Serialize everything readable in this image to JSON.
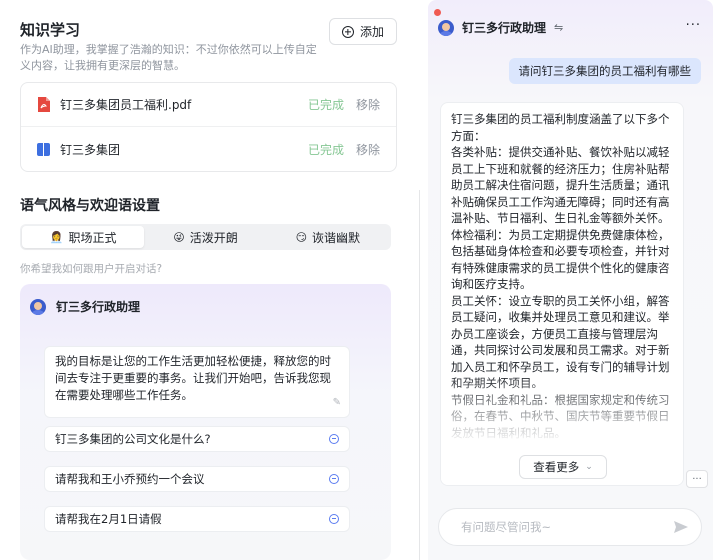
{
  "knowledge": {
    "title": "知识学习",
    "description": "作为AI助理，我掌握了浩瀚的知识：不过你依然可以上传自定义内容，让我拥有更深层的智慧。",
    "add_label": "添加",
    "files": [
      {
        "name": "钉三多集团员工福利.pdf",
        "status": "已完成",
        "remove": "移除",
        "icon": "pdf-icon"
      },
      {
        "name": "钉三多集团",
        "status": "已完成",
        "remove": "移除",
        "icon": "book-icon"
      }
    ]
  },
  "tone": {
    "title": "语气风格与欢迎语设置",
    "options": [
      {
        "emoji": "👩‍💼",
        "label": "职场正式",
        "active": true
      },
      {
        "emoji": "😜",
        "label": "活泼开朗",
        "active": false
      },
      {
        "emoji": "😏",
        "label": "诙谐幽默",
        "active": false
      }
    ],
    "hint": "你希望我如何跟用户开启对话?"
  },
  "preview": {
    "assistant_name": "钉三多行政助理",
    "greeting": "我的目标是让您的工作生活更加轻松便捷，释放您的时间去专注于更重要的事务。让我们开始吧，告诉我您现在需要处理哪些工作任务。",
    "questions": [
      "钉三多集团的公司文化是什么?",
      "请帮我和王小乔预约一个会议",
      "请帮我在2月1日请假"
    ]
  },
  "chat": {
    "title": "钉三多行政助理",
    "user_message": "请问钉三多集团的员工福利有哪些",
    "bot_message": "钉三多集团的员工福利制度涵盖了以下多个方面：\n各类补贴：提供交通补贴、餐饮补贴以减轻员工上下班和就餐的经济压力；住房补贴帮助员工解决住宿问题，提升生活质量；通讯补贴确保员工工作沟通无障碍；同时还有高温补贴、节日福利、生日礼金等额外关怀。\n体检福利：为员工定期提供免费健康体检，包括基础身体检查和必要专项检查，并针对有特殊健康需求的员工提供个性化的健康咨询和医疗支持。\n员工关怀：设立专职的员工关怀小组，解答员工疑问，收集并处理员工意见和建议。举办员工座谈会，方便员工直接与管理层沟通，共同探讨公司发展和员工需求。对于新加入员工和怀孕员工，设有专门的辅导计划和孕期关怀项目。\n节假日礼金和礼品：根据国家规定和传统习俗，在春节、中秋节、国庆节等重要节假日发放节日福利和礼品。",
    "see_more": "查看更多",
    "input_placeholder": "有问题尽管问我~"
  },
  "colors": {
    "accent": "#5b7cf0",
    "done": "#86c794",
    "user_bubble": "#dbe6fd",
    "pdf": "#e5483f",
    "book": "#3d6fe0"
  }
}
